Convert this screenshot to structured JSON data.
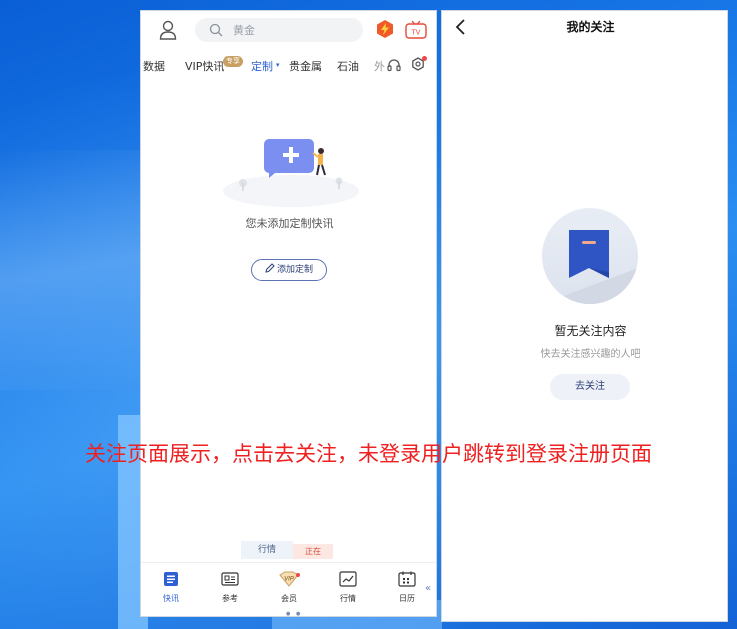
{
  "left_app": {
    "search": {
      "placeholder": "黄金"
    },
    "topbar": {
      "tv_label": "TV"
    },
    "tabs": [
      {
        "label": "数据"
      },
      {
        "label": "VIP快讯"
      },
      {
        "label": "定制"
      },
      {
        "label": "贵金属"
      },
      {
        "label": "石油"
      },
      {
        "label": "外"
      }
    ],
    "vip_badge": "专享",
    "tab_caret": "▾",
    "empty_state": {
      "message": "您未添加定制快讯",
      "add_button": "添加定制"
    },
    "mini_tabs": [
      "行情",
      "正在"
    ],
    "bottom_nav": [
      {
        "label": "快讯",
        "icon": "news-icon",
        "active": true
      },
      {
        "label": "参考",
        "icon": "reference-icon",
        "active": false
      },
      {
        "label": "会员",
        "icon": "vip-icon",
        "active": false
      },
      {
        "label": "行情",
        "icon": "chart-icon",
        "active": false
      },
      {
        "label": "日历",
        "icon": "calendar-icon",
        "active": false
      }
    ],
    "vip_nav_text": "VIP",
    "collapse_glyph": "«"
  },
  "right_app": {
    "title": "我的关注",
    "empty_title": "暂无关注内容",
    "empty_subtitle": "快去关注感兴趣的人吧",
    "follow_button": "去关注"
  },
  "caption": "关注页面展示，点击去关注，未登录用户跳转到登录注册页面",
  "colors": {
    "accent": "#2e5fd3",
    "caption": "#ee2020",
    "desktop": "#1a7ae8",
    "bookmark": "#2f55c5"
  }
}
